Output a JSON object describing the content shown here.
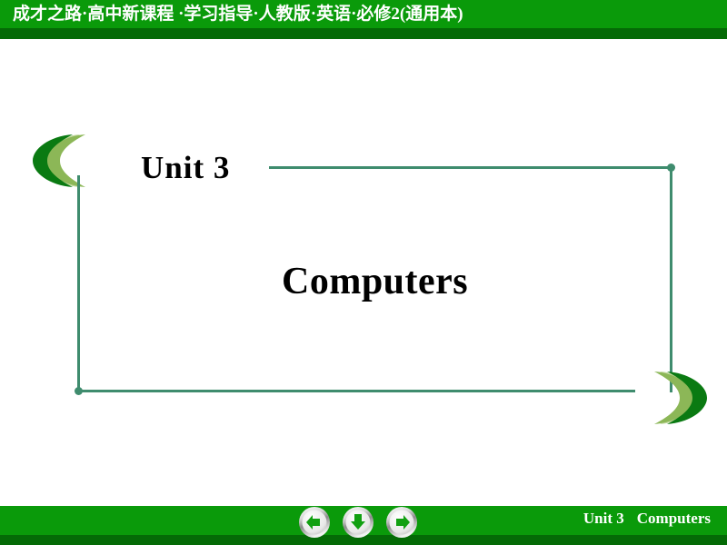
{
  "header": {
    "title": "成才之路·高中新课程 ·学习指导·人教版·英语·必修2(通用本)",
    "bright_green": "#0a9a0a",
    "dark_green": "#046a06"
  },
  "slide": {
    "unit_label": "Unit 3",
    "topic_label": "Computers",
    "frame_color": "#3f8c6e",
    "decoration": {
      "left_icon": "triple-crescent-left-icon",
      "right_icon": "triple-crescent-right-icon",
      "colors": [
        "#0a7a12",
        "#8cb757",
        "#c3d9a0"
      ]
    }
  },
  "footer": {
    "unit_label": "Unit 3",
    "topic_label": "Computers",
    "bright_green": "#0a9a0a",
    "dark_green": "#046a06",
    "nav": [
      {
        "name": "previous-slide-button",
        "icon": "arrow-left-icon",
        "direction": "left"
      },
      {
        "name": "next-section-button",
        "icon": "arrow-down-icon",
        "direction": "down"
      },
      {
        "name": "next-slide-button",
        "icon": "arrow-right-icon",
        "direction": "right"
      }
    ]
  }
}
